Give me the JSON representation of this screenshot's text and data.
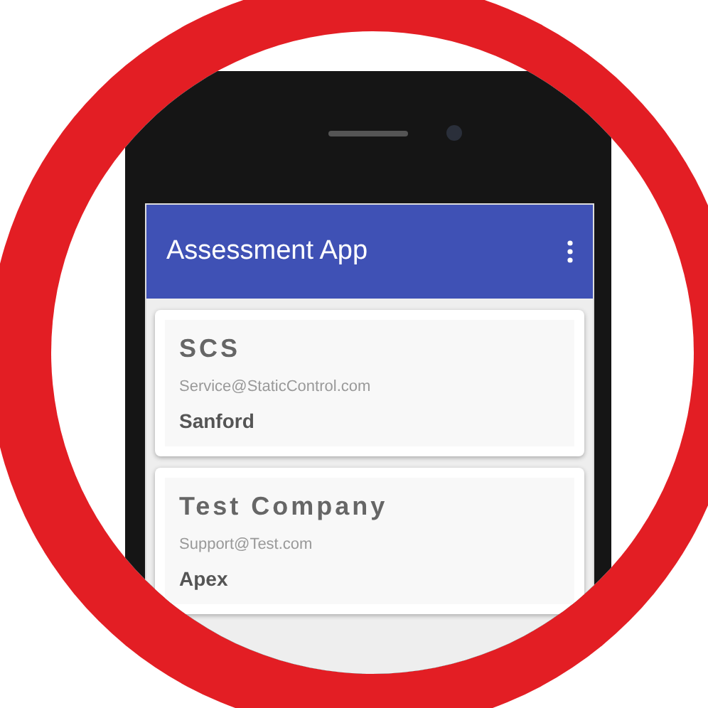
{
  "app_bar": {
    "title": "Assessment App"
  },
  "companies": [
    {
      "name": "SCS",
      "email": "Service@StaticControl.com",
      "city": "Sanford"
    },
    {
      "name": "Test Company",
      "email": "Support@Test.com",
      "city": "Apex"
    }
  ]
}
